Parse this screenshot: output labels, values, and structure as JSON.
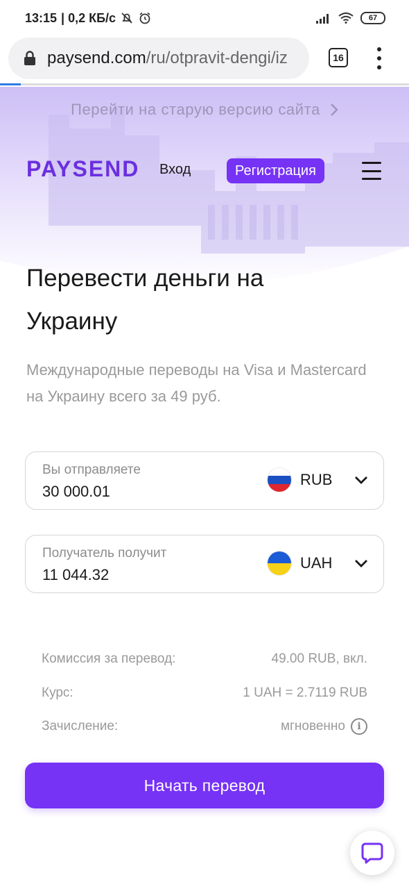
{
  "status_bar": {
    "time": "13:15",
    "net_speed": "| 0,2 КБ/с",
    "battery": "67"
  },
  "browser": {
    "url_host": "paysend.com",
    "url_path": "/ru/otpravit-dengi/iz",
    "tab_count": "16",
    "load_progress_percent": 5
  },
  "header": {
    "old_version_link": "Перейти на старую версию сайта",
    "logo_text": "PAYSEND",
    "login_label": "Вход",
    "register_label": "Регистрация",
    "brand_color": "#7632f5"
  },
  "main": {
    "title": "Перевести деньги на Украину",
    "subtitle": "Международные переводы на Visa и Mastercard на Украину всего за 49 руб."
  },
  "send_field": {
    "label": "Вы отправляете",
    "value": "30 000.01",
    "currency": "RUB",
    "flag": "russia-flag"
  },
  "receive_field": {
    "label": "Получатель получит",
    "value": "11 044.32",
    "currency": "UAH",
    "flag": "ukraine-flag"
  },
  "info": [
    {
      "label": "Комиссия за перевод:",
      "value": "49.00 RUB, вкл."
    },
    {
      "label": "Курс:",
      "value": "1 UAH = 2.7119 RUB"
    },
    {
      "label": "Зачисление:",
      "value": "мгновенно"
    }
  ],
  "actions": {
    "start_transfer_label": "Начать перевод",
    "chat_icon": "chat-icon"
  }
}
